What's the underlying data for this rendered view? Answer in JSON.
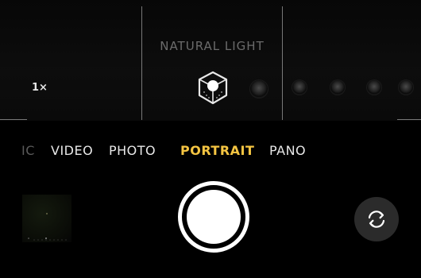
{
  "viewfinder": {
    "lighting_label": "NATURAL LIGHT",
    "zoom_label": "1×",
    "lighting_options": [
      "natural-light",
      "studio-light",
      "contour-light",
      "stage-light",
      "stage-light-mono",
      "high-key-light-mono"
    ]
  },
  "modes": {
    "cut_off": "IC",
    "video": "VIDEO",
    "photo": "PHOTO",
    "portrait": "PORTRAIT",
    "pano": "PANO",
    "active": "PORTRAIT"
  },
  "controls": {
    "shutter_icon": "shutter-button",
    "flip_icon": "camera-flip-icon",
    "thumbnail_icon": "last-photo-thumbnail"
  },
  "colors": {
    "background": "#000000",
    "active_mode": "#f5c542",
    "text": "#e8e8e8",
    "flip_bg": "#2b2b2b"
  }
}
